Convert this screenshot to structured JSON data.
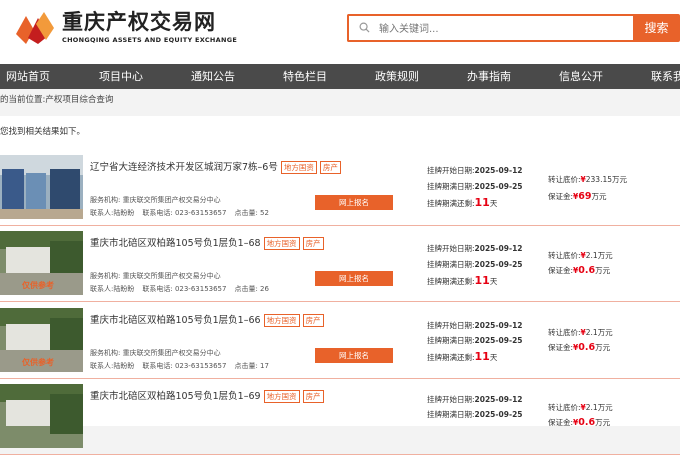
{
  "header": {
    "brand_cn": "重庆产权交易网",
    "brand_en": "CHONGQING ASSETS AND EQUITY EXCHANGE",
    "search_placeholder": "输入关键词...",
    "search_button": "搜索"
  },
  "nav": [
    "网站首页",
    "项目中心",
    "通知公告",
    "特色栏目",
    "政策规则",
    "办事指南",
    "信息公开",
    "联系我"
  ],
  "breadcrumb": "的当前位置:产权项目综合查询",
  "result_note": "您找到相关结果如下。",
  "colors": {
    "accent": "#e8622a",
    "nav_bg": "#4a4a4a",
    "price_red": "#e60012"
  },
  "labels": {
    "agency": "服务机构: 重庆联交所集团产权交易分中心",
    "contact": "联系人:陆盼盼",
    "phone": "联系电话: 023-63153657",
    "apply": "网上报名",
    "start_prefix": "挂牌开始日期:",
    "end_prefix": "挂牌期满日期:",
    "remain_prefix": "挂牌期满还剩:",
    "remain_unit": "天",
    "price_prefix": "转让底价:",
    "deposit_prefix": "保证金:",
    "ref_text": "仅供参考"
  },
  "items": [
    {
      "title": "辽宁省大连经济技术开发区城润万家7栋–6号",
      "tags": [
        "地方国资",
        "房产"
      ],
      "clicks": "点击量: 52",
      "start": "2025-09-12",
      "end": "2025-09-25",
      "remain": "11",
      "price_sym": "¥",
      "price": "233.15",
      "price_unit": "万元",
      "deposit_sym": "¥",
      "deposit": "69",
      "deposit_unit": "万元",
      "ref": false
    },
    {
      "title": "重庆市北碚区双柏路105号负1层负1–68",
      "tags": [
        "地方国资",
        "房产"
      ],
      "clicks": "点击量: 26",
      "start": "2025-09-12",
      "end": "2025-09-25",
      "remain": "11",
      "price_sym": "¥",
      "price": "2.1",
      "price_unit": "万元",
      "deposit_sym": "¥",
      "deposit": "0.6",
      "deposit_unit": "万元",
      "ref": true
    },
    {
      "title": "重庆市北碚区双柏路105号负1层负1–66",
      "tags": [
        "地方国资",
        "房产"
      ],
      "clicks": "点击量: 17",
      "start": "2025-09-12",
      "end": "2025-09-25",
      "remain": "11",
      "price_sym": "¥",
      "price": "2.1",
      "price_unit": "万元",
      "deposit_sym": "¥",
      "deposit": "0.6",
      "deposit_unit": "万元",
      "ref": true
    },
    {
      "title": "重庆市北碚区双柏路105号负1层负1–69",
      "tags": [
        "地方国资",
        "房产"
      ],
      "clicks": "",
      "start": "2025-09-12",
      "end": "2025-09-25",
      "remain": "",
      "price_sym": "¥",
      "price": "2.1",
      "price_unit": "万元",
      "deposit_sym": "¥",
      "deposit": "0.6",
      "deposit_unit": "万元",
      "ref": true
    }
  ]
}
